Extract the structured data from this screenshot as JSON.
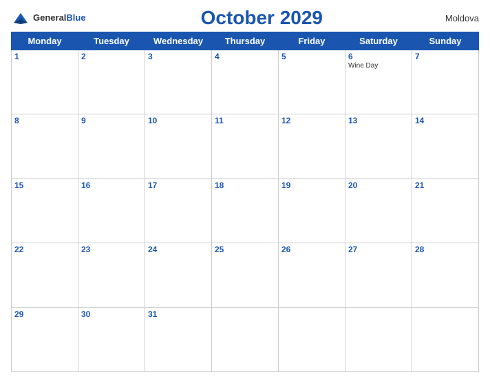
{
  "header": {
    "logo_general": "General",
    "logo_blue": "Blue",
    "title": "October 2029",
    "country": "Moldova"
  },
  "weekdays": [
    "Monday",
    "Tuesday",
    "Wednesday",
    "Thursday",
    "Friday",
    "Saturday",
    "Sunday"
  ],
  "weeks": [
    [
      {
        "day": "1",
        "events": []
      },
      {
        "day": "2",
        "events": []
      },
      {
        "day": "3",
        "events": []
      },
      {
        "day": "4",
        "events": []
      },
      {
        "day": "5",
        "events": []
      },
      {
        "day": "6",
        "events": [
          "Wine Day"
        ]
      },
      {
        "day": "7",
        "events": []
      }
    ],
    [
      {
        "day": "8",
        "events": []
      },
      {
        "day": "9",
        "events": []
      },
      {
        "day": "10",
        "events": []
      },
      {
        "day": "11",
        "events": []
      },
      {
        "day": "12",
        "events": []
      },
      {
        "day": "13",
        "events": []
      },
      {
        "day": "14",
        "events": []
      }
    ],
    [
      {
        "day": "15",
        "events": []
      },
      {
        "day": "16",
        "events": []
      },
      {
        "day": "17",
        "events": []
      },
      {
        "day": "18",
        "events": []
      },
      {
        "day": "19",
        "events": []
      },
      {
        "day": "20",
        "events": []
      },
      {
        "day": "21",
        "events": []
      }
    ],
    [
      {
        "day": "22",
        "events": []
      },
      {
        "day": "23",
        "events": []
      },
      {
        "day": "24",
        "events": []
      },
      {
        "day": "25",
        "events": []
      },
      {
        "day": "26",
        "events": []
      },
      {
        "day": "27",
        "events": []
      },
      {
        "day": "28",
        "events": []
      }
    ],
    [
      {
        "day": "29",
        "events": []
      },
      {
        "day": "30",
        "events": []
      },
      {
        "day": "31",
        "events": []
      },
      {
        "day": "",
        "events": []
      },
      {
        "day": "",
        "events": []
      },
      {
        "day": "",
        "events": []
      },
      {
        "day": "",
        "events": []
      }
    ]
  ]
}
